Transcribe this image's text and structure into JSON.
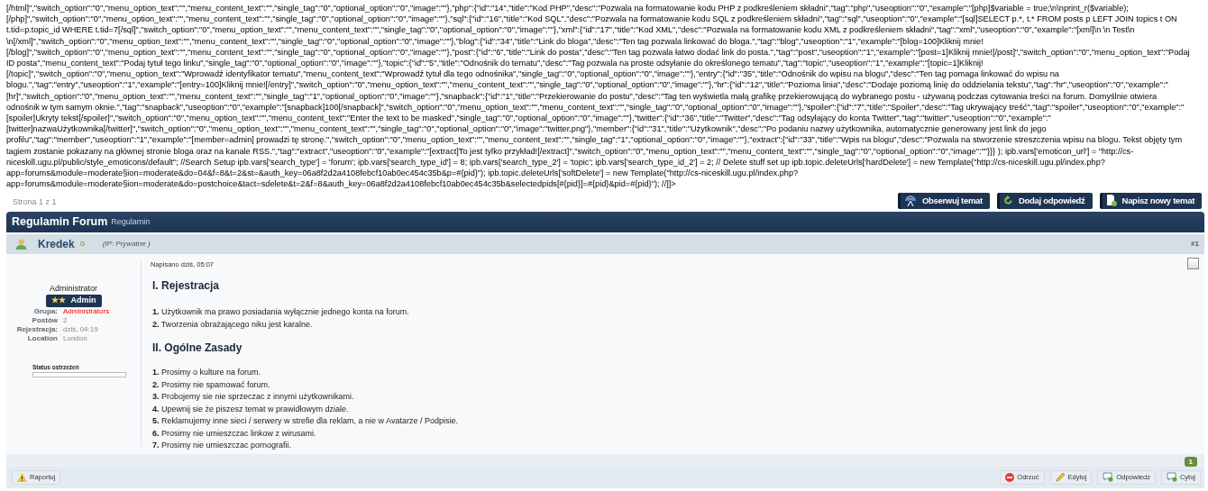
{
  "code_lines": [
    "[/html]\",\"switch_option\":\"0\",\"menu_option_text\":\"\",\"menu_content_text\":\"\",\"single_tag\":\"0\",\"optional_option\":\"0\",\"image\":\"\"},\"php\":{\"id\":\"14\",\"title\":\"Kod PHP\",\"desc\":\"Pozwala na formatowanie kodu PHP z podkreśleniem składni\",\"tag\":\"php\",\"useoption\":\"0\",\"example\":\"[php]$variable = true;\\n\\nprint_r($variable);",
    "[/php]\",\"switch_option\":\"0\",\"menu_option_text\":\"\",\"menu_content_text\":\"\",\"single_tag\":\"0\",\"optional_option\":\"0\",\"image\":\"\"},\"sql\":{\"id\":\"16\",\"title\":\"Kod SQL\",\"desc\":\"Pozwala na formatowanie kodu SQL z podkreśleniem składni\",\"tag\":\"sql\",\"useoption\":\"0\",\"example\":\"[sql]SELECT p.*, t.* FROM posts p LEFT JOIN topics t ON",
    "t.tid=p.topic_id WHERE t.tid=7[/sql]\",\"switch_option\":\"0\",\"menu_option_text\":\"\",\"menu_content_text\":\"\",\"single_tag\":\"0\",\"optional_option\":\"0\",\"image\":\"\"},\"xml\":{\"id\":\"17\",\"title\":\"Kod XML\",\"desc\":\"Pozwala na formatowanie kodu XML z podkreśleniem składni\",\"tag\":\"xml\",\"useoption\":\"0\",\"example\":\"[xml]\\n \\n Test\\n",
    "\\n[/xml]\",\"switch_option\":\"0\",\"menu_option_text\":\"\",\"menu_content_text\":\"\",\"single_tag\":\"0\",\"optional_option\":\"0\",\"image\":\"\"},\"blog\":{\"id\":\"34\",\"title\":\"Link do bloga\",\"desc\":\"Ten tag pozwala linkować do bloga.\",\"tag\":\"blog\",\"useoption\":\"1\",\"example\":\"[blog=100]Kliknij mnie!",
    "[/blog]\",\"switch_option\":\"0\",\"menu_option_text\":\"\",\"menu_content_text\":\"\",\"single_tag\":\"0\",\"optional_option\":\"0\",\"image\":\"\"},\"post\":{\"id\":\"6\",\"title\":\"Link do posta\",\"desc\":\"Ten tag pozwala łatwo dodać link do posta.\",\"tag\":\"post\",\"useoption\":\"1\",\"example\":\"[post=1]Kliknij mnie![/post]\",\"switch_option\":\"0\",\"menu_option_text\":\"Podaj",
    "ID posta\",\"menu_content_text\":\"Podaj tytuł tego linku\",\"single_tag\":\"0\",\"optional_option\":\"0\",\"image\":\"\"},\"topic\":{\"id\":\"5\",\"title\":\"Odnośnik do tematu\",\"desc\":\"Tag pozwala na proste odsyłanie do określonego tematu\",\"tag\":\"topic\",\"useoption\":\"1\",\"example\":\"[topic=1]Kliknij!",
    "[/topic]\",\"switch_option\":\"0\",\"menu_option_text\":\"Wprowadź identyfikator tematu\",\"menu_content_text\":\"Wprowadź tytuł dla tego odnośnika\",\"single_tag\":\"0\",\"optional_option\":\"0\",\"image\":\"\"},\"entry\":{\"id\":\"35\",\"title\":\"Odnośnik do wpisu na blogu\",\"desc\":\"Ten tag pomaga linkować do wpisu na",
    "blogu.\",\"tag\":\"entry\",\"useoption\":\"1\",\"example\":\"[entry=100]Kliknij mnie![/entry]\",\"switch_option\":\"0\",\"menu_option_text\":\"\",\"menu_content_text\":\"\",\"single_tag\":\"0\",\"optional_option\":\"0\",\"image\":\"\"},\"hr\":{\"id\":\"12\",\"title\":\"Pozioma linia\",\"desc\":\"Dodaje poziomą linię do oddzielania tekstu\",\"tag\":\"hr\",\"useoption\":\"0\",\"example\":\"",
    "[hr]\",\"switch_option\":\"0\",\"menu_option_text\":\"\",\"menu_content_text\":\"\",\"single_tag\":\"1\",\"optional_option\":\"0\",\"image\":\"\"},\"snapback\":{\"id\":\"1\",\"title\":\"Przekierowanie do postu\",\"desc\":\"Tag ten wyświetla małą grafikę przekierowującą do wybranego postu - używaną podczas cytowania treści na forum. Domyślnie otwiera",
    "odnośnik w tym samym oknie.\",\"tag\":\"snapback\",\"useoption\":\"0\",\"example\":\"[snapback]100[/snapback]\",\"switch_option\":\"0\",\"menu_option_text\":\"\",\"menu_content_text\":\"\",\"single_tag\":\"0\",\"optional_option\":\"0\",\"image\":\"\"},\"spoiler\":{\"id\":\"7\",\"title\":\"Spoiler\",\"desc\":\"Tag ukrywający treść\",\"tag\":\"spoiler\",\"useoption\":\"0\",\"example\":\"",
    "[spoiler]Ukryty tekst[/spoiler]\",\"switch_option\":\"0\",\"menu_option_text\":\"\",\"menu_content_text\":\"Enter the text to be masked\",\"single_tag\":\"0\",\"optional_option\":\"0\",\"image\":\"\"},\"twitter\":{\"id\":\"36\",\"title\":\"Twitter\",\"desc\":\"Tag odsyłający do konta Twitter\",\"tag\":\"twitter\",\"useoption\":\"0\",\"example\":\"",
    "[twitter]nazwaUżytkownika[/twitter]\",\"switch_option\":\"0\",\"menu_option_text\":\"\",\"menu_content_text\":\"\",\"single_tag\":\"0\",\"optional_option\":\"0\",\"image\":\"twitter.png\"},\"member\":{\"id\":\"31\",\"title\":\"Użytkownik\",\"desc\":\"Po podaniu nazwy użytkownika, automatycznie generowany jest link do jego",
    "profilu\",\"tag\":\"member\",\"useoption\":\"1\",\"example\":\"[member=admin] prowadzi tę stronę.\",\"switch_option\":\"0\",\"menu_option_text\":\"\",\"menu_content_text\":\"\",\"single_tag\":\"1\",\"optional_option\":\"0\",\"image\":\"\"},\"extract\":{\"id\":\"33\",\"title\":\"Wpis na blogu\",\"desc\":\"Pozwala na stworzenie streszczenia wpisu na blogu. Tekst objęty tym",
    "tagiem zostanie pokazany na głównej stronie bloga oraz na kanale RSS.\",\"tag\":\"extract\",\"useoption\":\"0\",\"example\":\"[extract]To jest tylko przykład![/extract]\",\"switch_option\":\"0\",\"menu_option_text\":\"\",\"menu_content_text\":\"\",\"single_tag\":\"0\",\"optional_option\":\"0\",\"image\":\"\"}}} ); ipb.vars['emoticon_url'] = \"http://cs-",
    "niceskill.ugu.pl/public/style_emoticons/default\"; //Search Setup ipb.vars['search_type'] = 'forum'; ipb.vars['search_type_id'] = 8; ipb.vars['search_type_2'] = 'topic'; ipb.vars['search_type_id_2'] = 2; // Delete stuff set up ipb.topic.deleteUrls['hardDelete'] = new Template(\"http://cs-niceskill.ugu.pl/index.php?",
    "app=forums&module=moderate§ion=moderate&do=04&f=8&t=2&st=&auth_key=06a8f2d2a4108febcf10ab0ec454c35b&p=#{pid}\"); ipb.topic.deleteUrls['softDelete'] = new Template(\"http://cs-niceskill.ugu.pl/index.php?",
    "app=forums&module=moderate§ion=moderate&do=postchoice&tact=sdelete&t=2&f=8&auth_key=06a8f2d2a4108febcf10ab0ec454c35b&selectedpids[#{pid}]=#{pid}&pid=#{pid}\"); //]]>"
  ],
  "pagination": "Strona 1 z 1",
  "topic_buttons": [
    {
      "label": "Obserwuj temat",
      "kind": "watch"
    },
    {
      "label": "Dodaj odpowiedź",
      "kind": "reply"
    },
    {
      "label": "Napisz nowy temat",
      "kind": "new"
    }
  ],
  "topic": {
    "title": "Regulamin Forum",
    "subtitle": "Regulamin"
  },
  "post": {
    "author": "Kredek",
    "ip": "(IP: Prywatne )",
    "number": "#1",
    "date": "Napisano dziś, 05:07",
    "checked": false,
    "profile": {
      "title": "Administrator",
      "rank_stars": "★★",
      "rank": "Admin",
      "fields": [
        {
          "label": "Grupa:",
          "value": "Administrators",
          "kind": "group"
        },
        {
          "label": "Postów",
          "value": "2",
          "kind": "plain"
        },
        {
          "label": "Rejestracja:",
          "value": "dziś, 04:19",
          "kind": "plain"
        },
        {
          "label": "Location",
          "value": "London",
          "kind": "plain"
        }
      ],
      "warn_label": "Status ostrzeżeń"
    },
    "sections": [
      {
        "heading": "I. Rejestracja",
        "items": [
          "**1.** Użytkownik ma prawo posiadania wyłącznie jednego konta na forum.",
          "**2.** Tworzenia obrażającego niku jest karalne."
        ]
      },
      {
        "heading": "II. Ogólne Zasady",
        "items": [
          "**1.** Prosimy o kulture na forum.",
          "**2.** Prosimy nie spamować forum.",
          "**3.** Probojemy sie nie sprzeczac z innymi użytkownikami.",
          "**4.** Upewnij sie że piszesz temat w prawidłowym dziale.",
          "**5.** Reklamujemy inne sieci / serwery w strefie dla reklam, a nie w Avatarze / Podpisie.",
          "**6.** Prosimy nie umieszczac linkow z wirusami.",
          "**7.** Prosimy nie umieszczac pornografii."
        ]
      }
    ],
    "reputation": "1",
    "report": "Raportuj",
    "actions": [
      {
        "label": "Odrzuć",
        "kind": "reject"
      },
      {
        "label": "Edytuj",
        "kind": "edit"
      },
      {
        "label": "Odpowiedz",
        "kind": "reply"
      },
      {
        "label": "Cytuj",
        "kind": "quote"
      }
    ]
  }
}
